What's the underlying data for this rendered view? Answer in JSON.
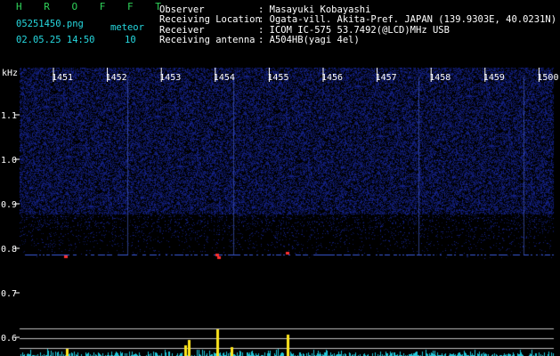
{
  "header": {
    "app_title": "H R O F F T",
    "filename": "05251450.png",
    "datetime": "02.05.25 14:50",
    "meteor_label": "meteor",
    "meteor_count": "10",
    "fields": [
      {
        "label": "Observer",
        "value": ": Masayuki Kobayashi"
      },
      {
        "label": "Receiving Location",
        "value": ": Ogata-vill. Akita-Pref. JAPAN (139.9303E, 40.0231N)"
      },
      {
        "label": "Receiver",
        "value": ": ICOM IC-575 53.7492(@LCD)MHz USB"
      },
      {
        "label": "Receiving antenna",
        "value": ": A504HB(yagi 4el)"
      }
    ]
  },
  "spectrogram": {
    "y_unit": "kHz",
    "y_ticks": [
      "1.1",
      "1.0",
      "0.9",
      "0.8",
      "0.7",
      "0.6"
    ],
    "x_ticks": [
      "1451",
      "1452",
      "1453",
      "1454",
      "1455",
      "1456",
      "1457",
      "1458",
      "1459",
      "1500"
    ],
    "colors": {
      "background": "#000000",
      "noise": "#141e78",
      "echo_line": "#3a5ad8",
      "hot": "#ff3030",
      "bars_cyan": "#21c6d8",
      "bars_yellow": "#ffe61e",
      "axis_text": "#ffffff"
    }
  }
}
